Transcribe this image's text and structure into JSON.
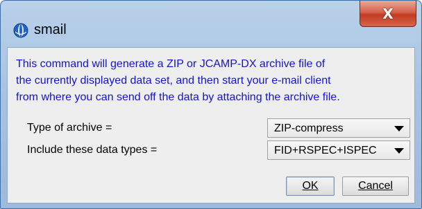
{
  "window": {
    "title": "smail",
    "icon": "bruker-logo-icon",
    "close_glyph": "X"
  },
  "description": {
    "lines": [
      "This command will generate a ZIP or JCAMP-DX archive file of",
      "the currently displayed data set, and then start your e-mail client",
      "from where you can send off the data by attaching the archive file."
    ],
    "color": "#1515c8"
  },
  "form": {
    "archive_type": {
      "label": "Type of archive =",
      "selected": "ZIP-compress"
    },
    "data_types": {
      "label": "Include these data types =",
      "selected": "FID+RSPEC+ISPEC"
    }
  },
  "buttons": {
    "ok": "OK",
    "cancel": "Cancel"
  },
  "colors": {
    "title_bar": "#a9c4e2",
    "close_button": "#c43b22",
    "client_bg": "#eeeeee"
  }
}
